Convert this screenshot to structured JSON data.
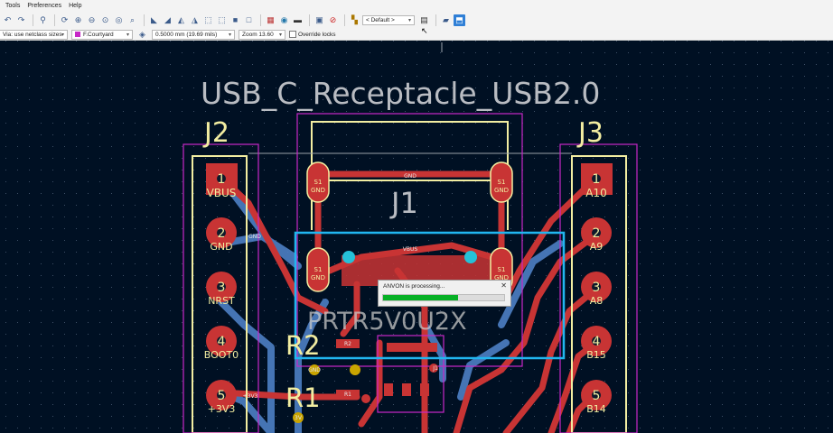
{
  "menubar": {
    "items": [
      "Tools",
      "Preferences",
      "Help"
    ]
  },
  "toolbar": {
    "icons": [
      "undo-icon",
      "redo-icon",
      "find-icon",
      "refresh-icon",
      "zoom-in-icon",
      "zoom-out-icon",
      "zoom-fit-icon",
      "zoom-selection-icon",
      "zoom-object-icon",
      "rotate-ccw-icon",
      "rotate-cw-icon",
      "flip-icon",
      "mirror-icon",
      "group-icon",
      "ungroup-icon",
      "lock-icon",
      "unlock-icon",
      "netlist-icon",
      "drc-icon",
      "board-setup-icon",
      "3d-viewer-icon",
      "scripting-icon",
      "layer-pair-icon",
      "plugin-icon",
      "anvon-plugin-icon"
    ],
    "preset": "< Default >"
  },
  "auxbar": {
    "via_size": "Via: use netclass sizes",
    "layer": "F.Courtyard",
    "grid": "0.5000 mm (19.69 mils)",
    "zoom": "Zoom 13.60",
    "override_locks": "Override locks",
    "override_locks_checked": false
  },
  "pcb": {
    "title": "USB_C_Receptacle_USB2.0",
    "refs": {
      "j1": "J1",
      "j2": "J2",
      "j3": "J3",
      "r2": "R2",
      "r1": "R1",
      "u_ghost": "PRTR5V0U2X"
    },
    "j2_pins": [
      {
        "num": "1",
        "name": "VBUS"
      },
      {
        "num": "2",
        "name": "GND"
      },
      {
        "num": "3",
        "name": "NRST"
      },
      {
        "num": "4",
        "name": "BOOT0"
      },
      {
        "num": "5",
        "name": "+3V3"
      }
    ],
    "j3_pins": [
      {
        "num": "1",
        "name": "A10"
      },
      {
        "num": "2",
        "name": "A9"
      },
      {
        "num": "3",
        "name": "A8"
      },
      {
        "num": "4",
        "name": "B15"
      },
      {
        "num": "5",
        "name": "B14"
      }
    ],
    "j1_pad_num": "S1",
    "j1_pad_net": "GND",
    "net_labels": {
      "vbus": "VBUS",
      "gnd": "GND",
      "v3": "+3V3",
      "v3b": "3V",
      "r2": "R2",
      "r1": "R1",
      "j1b": "J1"
    }
  },
  "progress_dialog": {
    "message": "ANVON is processing...",
    "progress_percent": 62,
    "close": "✕"
  },
  "colors": {
    "copper_front": "#c83434",
    "copper_back": "#4d7fc4",
    "silkscreen": "#f2eda1",
    "courtyard": "#c728c7",
    "selection": "#21b6f0",
    "background": "#001023"
  }
}
